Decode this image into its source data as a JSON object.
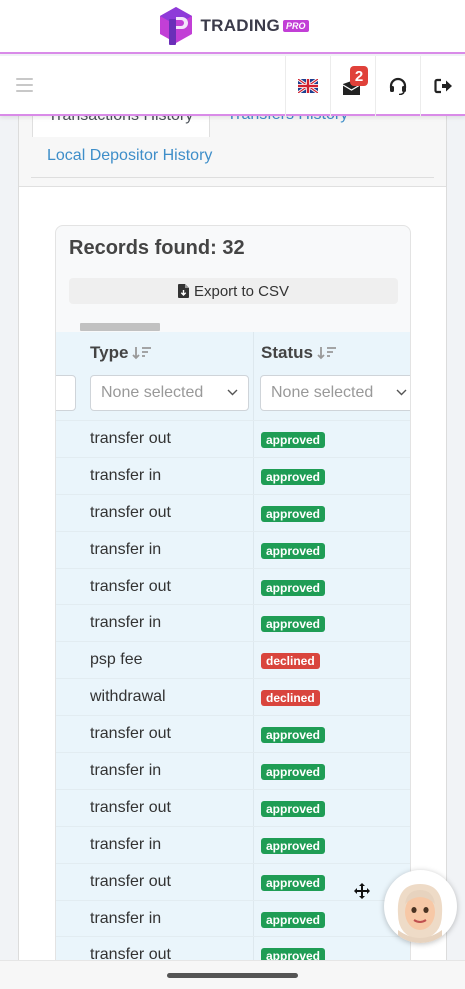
{
  "brand": {
    "name": "TRADING",
    "tag": "PRO",
    "colors": {
      "primary": "#c23fd6",
      "dark": "#3b3b4a"
    }
  },
  "topbar": {
    "menu_icon": "hamburger-icon",
    "flag_icon": "uk-flag-icon",
    "messages": {
      "icon": "envelope-icon",
      "count": "2"
    },
    "support_icon": "headset-icon",
    "logout_icon": "logout-icon"
  },
  "tabs": [
    {
      "label": "Transactions History",
      "active": true
    },
    {
      "label": "Transfers History",
      "active": false
    },
    {
      "label": "Local Depositor History",
      "active": false
    }
  ],
  "records": {
    "title": "Records found: 32",
    "export_label": "Export to CSV"
  },
  "table": {
    "columns": [
      {
        "label": "Type",
        "filter_placeholder": "None selected"
      },
      {
        "label": "Status",
        "filter_placeholder": "None selected"
      }
    ],
    "rows": [
      {
        "type": "transfer out",
        "status": "approved"
      },
      {
        "type": "transfer in",
        "status": "approved"
      },
      {
        "type": "transfer out",
        "status": "approved"
      },
      {
        "type": "transfer in",
        "status": "approved"
      },
      {
        "type": "transfer out",
        "status": "approved"
      },
      {
        "type": "transfer in",
        "status": "approved"
      },
      {
        "type": "psp fee",
        "status": "declined"
      },
      {
        "type": "withdrawal",
        "status": "declined"
      },
      {
        "type": "transfer out",
        "status": "approved"
      },
      {
        "type": "transfer in",
        "status": "approved"
      },
      {
        "type": "transfer out",
        "status": "approved"
      },
      {
        "type": "transfer in",
        "status": "approved"
      },
      {
        "type": "transfer out",
        "status": "approved"
      },
      {
        "type": "transfer in",
        "status": "approved"
      },
      {
        "type": "transfer out",
        "status": "approved"
      }
    ],
    "status_colors": {
      "approved": "#1f9d55",
      "declined": "#d9453d"
    }
  },
  "widgets": {
    "move_icon": "move-arrows-icon",
    "chat_avatar": "support-avatar-icon"
  }
}
